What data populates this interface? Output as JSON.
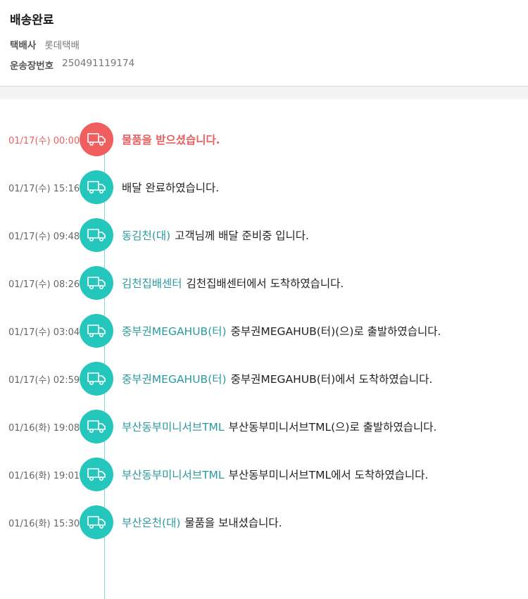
{
  "header": {
    "title": "배송완료",
    "carrier_label": "택배사",
    "carrier_value": "롯데택배",
    "tracking_label": "운송장번호",
    "tracking_value": "250491119174"
  },
  "colors": {
    "accent_teal": "#25c7bd",
    "accent_red": "#ef5f5f",
    "location_text": "#2a9aa0"
  },
  "events": [
    {
      "time": "01/17(수) 00:00",
      "location": "",
      "message": "물품을 받으셨습니다.",
      "icon": "truck-icon"
    },
    {
      "time": "01/17(수) 15:16",
      "location": "",
      "message": "배달 완료하였습니다.",
      "icon": "truck-icon"
    },
    {
      "time": "01/17(수) 09:48",
      "location": "동김천(대)",
      "message": "고객님께 배달 준비중 입니다.",
      "icon": "truck-icon"
    },
    {
      "time": "01/17(수) 08:26",
      "location": "김천집배센터",
      "message": "김천집배센터에서 도착하였습니다.",
      "icon": "truck-icon"
    },
    {
      "time": "01/17(수) 03:04",
      "location": "중부권MEGAHUB(터)",
      "message": "중부권MEGAHUB(터)(으)로 출발하였습니다.",
      "icon": "truck-icon"
    },
    {
      "time": "01/17(수) 02:59",
      "location": "중부권MEGAHUB(터)",
      "message": "중부권MEGAHUB(터)에서 도착하였습니다.",
      "icon": "truck-icon"
    },
    {
      "time": "01/16(화) 19:08",
      "location": "부산동부미니서브TML",
      "message": "부산동부미니서브TML(으)로 출발하였습니다.",
      "icon": "truck-icon"
    },
    {
      "time": "01/16(화) 19:01",
      "location": "부산동부미니서브TML",
      "message": "부산동부미니서브TML에서 도착하였습니다.",
      "icon": "truck-icon"
    },
    {
      "time": "01/16(화) 15:30",
      "location": "부산온천(대)",
      "message": "물품을 보내셨습니다.",
      "icon": "truck-icon"
    }
  ]
}
